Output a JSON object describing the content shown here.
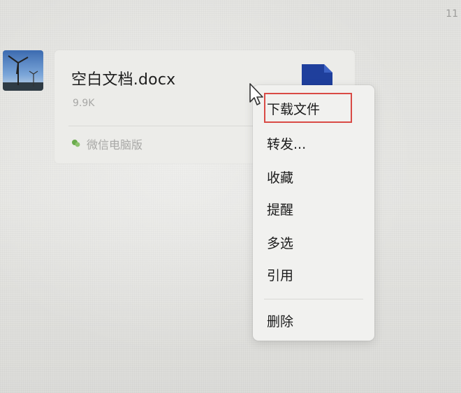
{
  "chat": {
    "timestamp": "11",
    "sender_avatar": "wind-turbine-photo"
  },
  "file_message": {
    "file_name": "空白文档.docx",
    "file_size": "9.9K",
    "source_app": "微信电脑版",
    "file_type_icon": "word-document-icon"
  },
  "context_menu": {
    "items": [
      {
        "label": "下载文件",
        "highlighted": true
      },
      {
        "label": "转发..."
      },
      {
        "label": "收藏"
      },
      {
        "label": "提醒"
      },
      {
        "label": "多选"
      },
      {
        "label": "引用"
      },
      {
        "label": "删除"
      }
    ]
  },
  "colors": {
    "highlight_border": "#d94a45",
    "word_blue": "#1f3f9c",
    "wechat_green": "#6aaa4c"
  }
}
